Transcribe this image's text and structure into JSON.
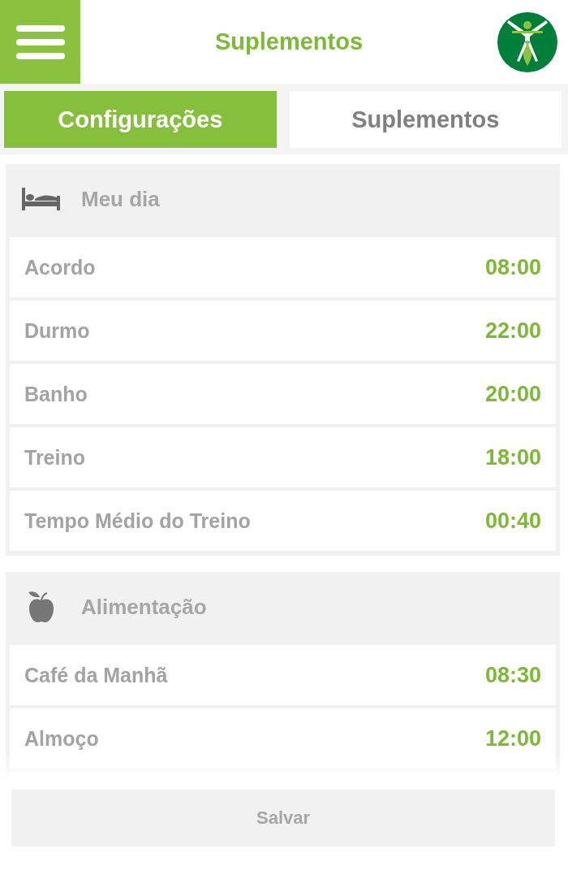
{
  "header": {
    "title": "Suplementos"
  },
  "tabs": [
    {
      "label": "Configurações",
      "selected": true
    },
    {
      "label": "Suplementos",
      "selected": false
    }
  ],
  "sections": [
    {
      "kind": "sleep",
      "title": "Meu dia",
      "rows": [
        {
          "label": "Acordo",
          "time": "08:00"
        },
        {
          "label": "Durmo",
          "time": "22:00"
        },
        {
          "label": "Banho",
          "time": "20:00"
        },
        {
          "label": "Treino",
          "time": "18:00"
        },
        {
          "label": "Tempo Médio do Treino",
          "time": "00:40"
        }
      ]
    },
    {
      "kind": "food",
      "title": "Alimentação",
      "rows": [
        {
          "label": "Café da Manhã",
          "time": "08:30"
        },
        {
          "label": "Almoço",
          "time": "12:00"
        }
      ]
    }
  ],
  "save_button": "Salvar"
}
